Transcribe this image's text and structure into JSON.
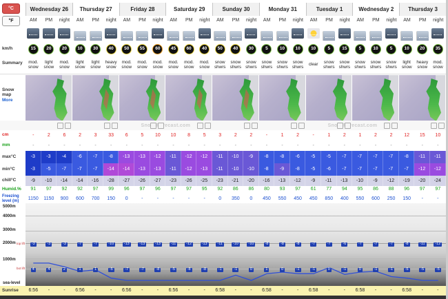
{
  "units": {
    "celsius": "°C",
    "fahrenheit": "°F"
  },
  "days": [
    {
      "name": "Wednesday 26",
      "periods": [
        "AM",
        "PM",
        "night"
      ]
    },
    {
      "name": "Thursday 27",
      "periods": [
        "AM",
        "PM",
        "night"
      ]
    },
    {
      "name": "Friday 28",
      "periods": [
        "AM",
        "PM",
        "night"
      ]
    },
    {
      "name": "Saturday 29",
      "periods": [
        "AM",
        "PM",
        "night"
      ]
    },
    {
      "name": "Sunday 30",
      "periods": [
        "AM",
        "PM",
        "night"
      ]
    },
    {
      "name": "Monday 31",
      "periods": [
        "AM",
        "PM",
        "night"
      ]
    },
    {
      "name": "Tuesday 1",
      "periods": [
        "AM",
        "PM",
        "night"
      ]
    },
    {
      "name": "Wednesday 2",
      "periods": [
        "AM",
        "PM",
        "night"
      ]
    },
    {
      "name": "Thursday 3",
      "periods": [
        "AM",
        "PM",
        "night"
      ]
    }
  ],
  "labels": {
    "wind": "km/h",
    "summary": "Summary",
    "snow_map": "Snow map",
    "snow_map_more": "More",
    "snow": "cm",
    "rain": "mm",
    "max": "max°C",
    "min": "min°C",
    "chill": "chill°C",
    "humid": "Humid.%",
    "freezing": "Freezing level (m)",
    "alt_5000": "5000m",
    "alt_4000": "4000m",
    "alt_3000": "3000m",
    "alt_2000": "2000m",
    "alt_1000": "1000m",
    "sea_level": "sea-level",
    "top_lift": "top lift",
    "bot_lift": "bot lift",
    "sunrise": "Sunrise"
  },
  "watermark": "Snow-Forecast.com",
  "weather_icons": [
    "night",
    "night",
    "night",
    "day",
    "day",
    "night",
    "day",
    "day",
    "night",
    "day",
    "day",
    "night",
    "day",
    "day",
    "night",
    "day",
    "day",
    "night",
    "sun",
    "day",
    "night",
    "day",
    "day",
    "night",
    "day",
    "day",
    "night"
  ],
  "wind": [
    15,
    20,
    20,
    10,
    30,
    40,
    50,
    55,
    60,
    45,
    60,
    40,
    50,
    40,
    30,
    5,
    10,
    10,
    10,
    5,
    15,
    5,
    10,
    5,
    10,
    20,
    35
  ],
  "wind_colors": [
    "g",
    "g",
    "g",
    "g",
    "g",
    "y",
    "y",
    "y",
    "o",
    "y",
    "y",
    "y",
    "y",
    "y",
    "g",
    "g",
    "g",
    "g",
    "g",
    "g",
    "g",
    "g",
    "g",
    "g",
    "g",
    "g",
    "g"
  ],
  "summary": [
    "mod. snow",
    "light snow",
    "mod. snow",
    "light snow",
    "light snow",
    "heavy snow",
    "mod. snow",
    "mod. snow",
    "mod. snow",
    "mod. snow",
    "mod. snow",
    "mod. snow",
    "snow shwrs",
    "snow shwrs",
    "snow shwrs",
    "snow shwrs",
    "snow shwrs",
    "snow shwrs",
    "clear",
    "snow shwrs",
    "snow shwrs",
    "snow shwrs",
    "snow shwrs",
    "snow shwrs",
    "light snow",
    "heavy snow",
    "mod. snow"
  ],
  "snow_cm": [
    "-",
    "2",
    "6",
    "2",
    "3",
    "33",
    "6",
    "5",
    "10",
    "10",
    "8",
    "5",
    "3",
    "2",
    "2",
    "-",
    "1",
    "2",
    "-",
    "1",
    "2",
    "1",
    "2",
    "2",
    "12",
    "15",
    "10"
  ],
  "rain_mm": [
    "-",
    "-",
    "-",
    "-",
    "-",
    "-",
    "-",
    "-",
    "-",
    "-",
    "-",
    "-",
    "-",
    "-",
    "-",
    "-",
    "-",
    "-",
    "-",
    "-",
    "-",
    "-",
    "-",
    "-",
    "-",
    "-",
    "-"
  ],
  "max": [
    "-3",
    "-3",
    "-4",
    "-6",
    "-7",
    "-8",
    "-13",
    "-13",
    "-12",
    "-11",
    "-12",
    "-12",
    "-11",
    "-10",
    "-9",
    "-8",
    "-8",
    "-6",
    "-5",
    "-5",
    "-7",
    "-7",
    "-7",
    "-7",
    "-8",
    "-11",
    "-11"
  ],
  "min": [
    "-3",
    "-5",
    "-7",
    "-7",
    "-7",
    "-14",
    "-14",
    "-13",
    "-13",
    "-11",
    "-12",
    "-13",
    "-11",
    "-10",
    "-10",
    "-8",
    "-9",
    "-8",
    "-5",
    "-6",
    "-7",
    "-7",
    "-7",
    "-7",
    "-7",
    "-12",
    "-12"
  ],
  "chill": [
    "-9",
    "-10",
    "-14",
    "-14",
    "-16",
    "-28",
    "-27",
    "-26",
    "-27",
    "-23",
    "-26",
    "-25",
    "-23",
    "-21",
    "-20",
    "-16",
    "-13",
    "-12",
    "-9",
    "-11",
    "-13",
    "-10",
    "-9",
    "-12",
    "-19",
    "-20",
    "-24"
  ],
  "humid": [
    "91",
    "97",
    "92",
    "92",
    "97",
    "99",
    "96",
    "97",
    "96",
    "97",
    "97",
    "95",
    "92",
    "86",
    "86",
    "80",
    "93",
    "97",
    "61",
    "77",
    "94",
    "95",
    "86",
    "88",
    "96",
    "97",
    "97"
  ],
  "freezing": [
    "1150",
    "1150",
    "900",
    "600",
    "700",
    "150",
    "0",
    "-",
    "-",
    "-",
    "-",
    "-",
    "0",
    "350",
    "0",
    "450",
    "550",
    "450",
    "450",
    "850",
    "400",
    "550",
    "600",
    "250",
    "150",
    "-",
    "-"
  ],
  "lift_top": [
    "-3",
    "-3",
    "-3",
    "-7",
    "-7",
    "-10",
    "-13",
    "-13",
    "-13",
    "-11",
    "-12",
    "-13",
    "-11",
    "-10",
    "-10",
    "-8",
    "-8",
    "-8",
    "-7",
    "-7",
    "-6",
    "-7",
    "-7",
    "-7",
    "-8",
    "-11",
    "-12"
  ],
  "lift_bot": [
    "4",
    "4",
    "2",
    "1",
    "1",
    "-5",
    "-7",
    "-7",
    "-8",
    "-5",
    "-8",
    "-8",
    "-1",
    "-1",
    "0",
    "1",
    "0",
    "-1",
    "-1",
    "0",
    "-1",
    "0",
    "-1",
    "-1",
    "-5",
    "-5",
    "-5"
  ],
  "sunrise": [
    "6:56",
    "-",
    "-",
    "6:56",
    "-",
    "-",
    "6:56",
    "-",
    "-",
    "6:56",
    "-",
    "-",
    "6:58",
    "-",
    "-",
    "6:58",
    "-",
    "-",
    "6:58",
    "-",
    "-",
    "6:58",
    "-",
    "-",
    "6:58",
    "-",
    "-"
  ]
}
